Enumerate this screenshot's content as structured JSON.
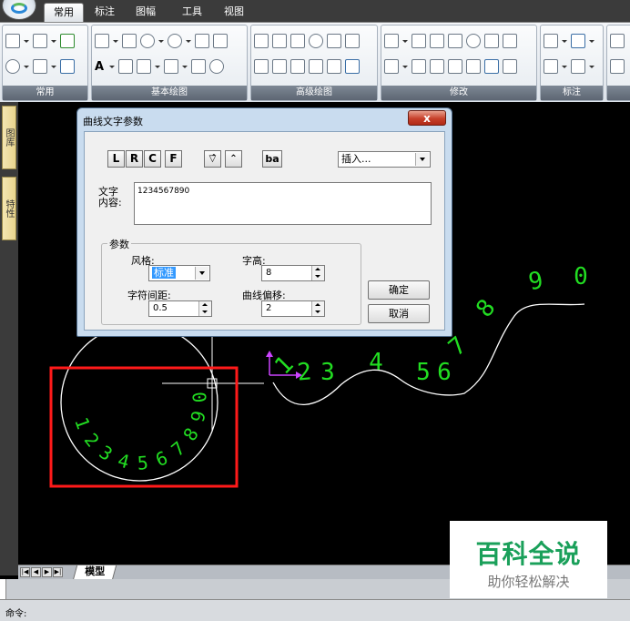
{
  "ribbon": {
    "tabs": [
      "常用",
      "标注",
      "图幅",
      "工具",
      "视图"
    ],
    "active_tab": "常用",
    "panels": [
      "常用",
      "基本绘图",
      "高级绘图",
      "修改",
      "标注"
    ],
    "text_tool_label": "A"
  },
  "side_tabs": [
    "图库",
    "特性"
  ],
  "dialog": {
    "title": "曲线文字参数",
    "close_label": "x",
    "align_buttons": [
      "L",
      "R",
      "C",
      "F"
    ],
    "extra_buttons": [
      "flip-up-icon",
      "flip-down-icon"
    ],
    "reverse_label": "ba",
    "insert_combo": "插入...",
    "content_label": "文字内容:",
    "content_value": "1234567890",
    "params": {
      "legend": "参数",
      "style_label": "风格:",
      "style_value": "标准",
      "height_label": "字高:",
      "height_value": "8",
      "spacing_label": "字符间距:",
      "spacing_value": "0.5",
      "offset_label": "曲线偏移:",
      "offset_value": "2"
    },
    "ok_label": "确定",
    "cancel_label": "取消"
  },
  "canvas": {
    "circle_text": "1234567890",
    "curve_text": "1234567890",
    "colors": {
      "curve_text": "#22dd22",
      "highlight_box": "#ff1a1a",
      "geometry": "#ffffff",
      "ucs": "#cc44ff"
    }
  },
  "model_tab": "模型",
  "command_prompt": "命令:",
  "watermark": {
    "title": "百科全说",
    "subtitle": "助你轻松解决"
  }
}
